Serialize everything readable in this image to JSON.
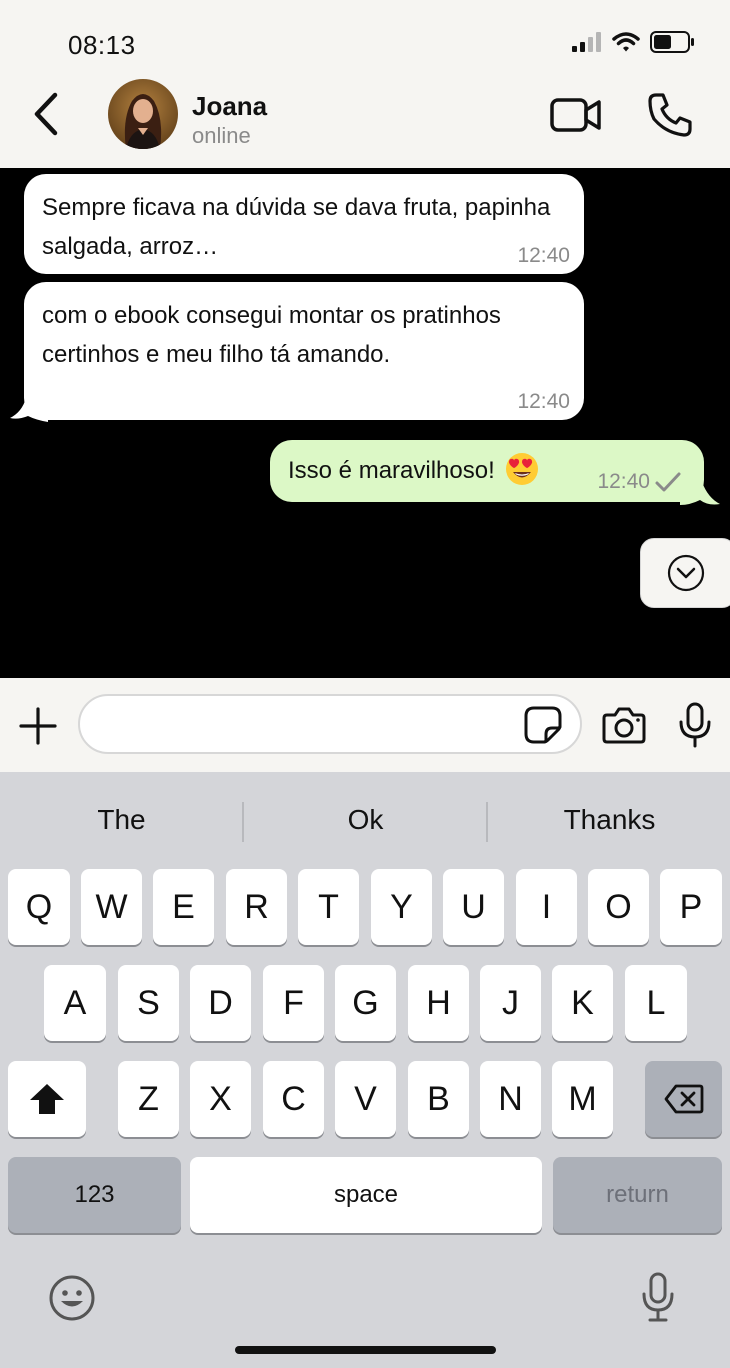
{
  "status_bar": {
    "time": "08:13"
  },
  "header": {
    "contact_name": "Joana",
    "contact_status": "online"
  },
  "messages": [
    {
      "direction": "incoming",
      "text": "Sempre ficava na dúvida se dava fruta, papinha salgada, arroz…",
      "time": "12:40"
    },
    {
      "direction": "incoming",
      "text": "com o ebook consegui montar os pratinhos certinhos e meu filho tá amando.",
      "time": "12:40"
    },
    {
      "direction": "outgoing",
      "text": "Isso é maravilhoso!",
      "emoji": "smiling-face-with-heart-eyes",
      "time": "12:40",
      "status": "sent-check"
    }
  ],
  "input": {
    "value": "",
    "placeholder": ""
  },
  "keyboard": {
    "suggestions": [
      "The",
      "Ok",
      "Thanks"
    ],
    "row1": [
      "Q",
      "W",
      "E",
      "R",
      "T",
      "Y",
      "U",
      "I",
      "O",
      "P"
    ],
    "row2": [
      "A",
      "S",
      "D",
      "F",
      "G",
      "H",
      "J",
      "K",
      "L"
    ],
    "row3": [
      "Z",
      "X",
      "C",
      "V",
      "B",
      "N",
      "M"
    ],
    "numbers_label": "123",
    "space_label": "space",
    "return_label": "return"
  },
  "colors": {
    "header_bg": "#f6f5f2",
    "chat_bg": "#000000",
    "incoming_bubble": "#ffffff",
    "outgoing_bubble": "#dcf8c6",
    "keyboard_bg": "#d4d5d9",
    "special_key": "#acb0b8"
  }
}
